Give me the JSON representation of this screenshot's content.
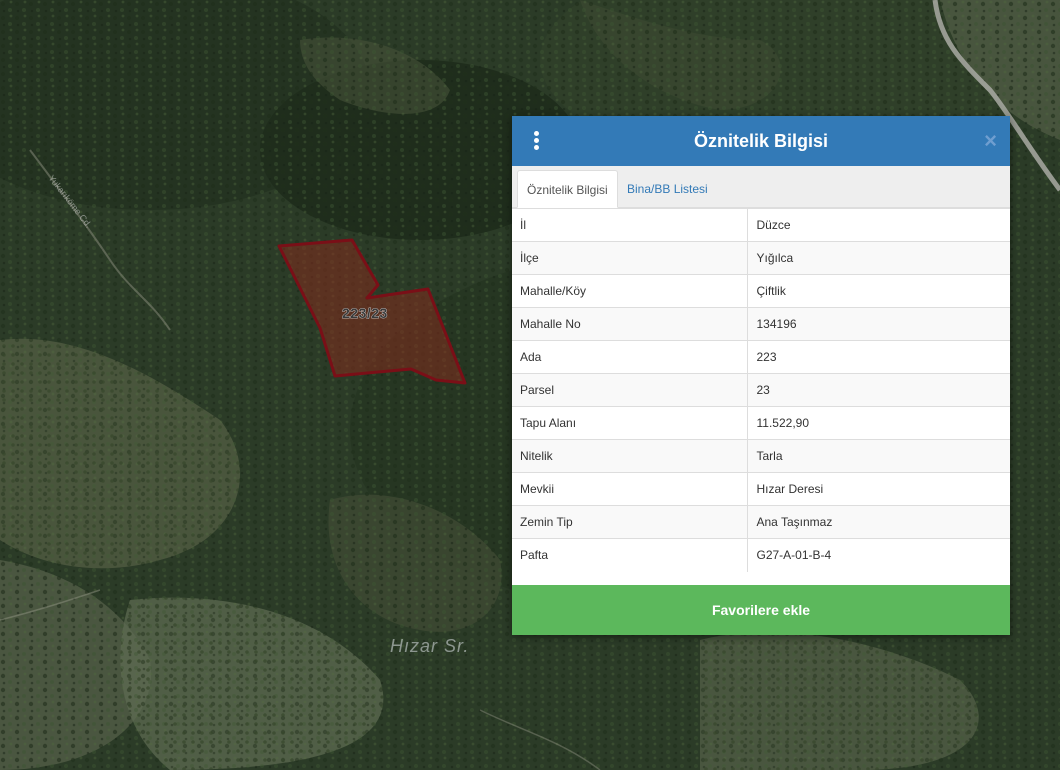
{
  "map": {
    "parcel_label": "223/23",
    "place_label": "Hızar Sr.",
    "road_label": "Yukarıköme Cd."
  },
  "panel": {
    "title": "Öznitelik Bilgisi",
    "menu_icon": "vertical-dots-icon",
    "close_icon": "close-icon",
    "close_glyph": "×",
    "tabs": [
      {
        "label": "Öznitelik Bilgisi",
        "active": true
      },
      {
        "label": "Bina/BB Listesi",
        "active": false
      }
    ],
    "rows": [
      {
        "key": "İl",
        "value": "Düzce"
      },
      {
        "key": "İlçe",
        "value": "Yığılca"
      },
      {
        "key": "Mahalle/Köy",
        "value": "Çiftlik"
      },
      {
        "key": "Mahalle No",
        "value": "134196"
      },
      {
        "key": "Ada",
        "value": "223"
      },
      {
        "key": "Parsel",
        "value": "23"
      },
      {
        "key": "Tapu Alanı",
        "value": "11.522,90"
      },
      {
        "key": "Nitelik",
        "value": "Tarla"
      },
      {
        "key": "Mevkii",
        "value": "Hızar Deresi"
      },
      {
        "key": "Zemin Tip",
        "value": "Ana Taşınmaz"
      },
      {
        "key": "Pafta",
        "value": "G27-A-01-B-4"
      }
    ],
    "favorite_button": "Favorilere ekle"
  },
  "colors": {
    "header": "#337ab7",
    "favorite": "#5cb85c",
    "parcel_stroke": "#7a0f17",
    "parcel_fill": "#8b2a1c"
  }
}
